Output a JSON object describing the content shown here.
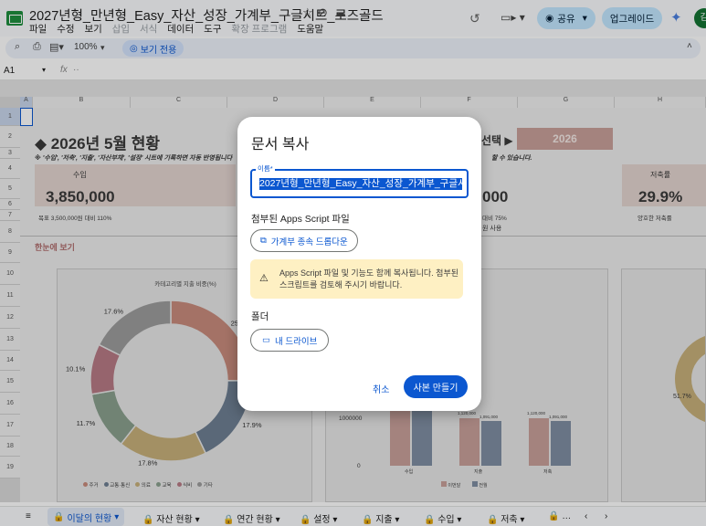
{
  "app": {
    "doc_title": "2027년형_만년형_Easy_자산_성장_가계부_구글시트_로즈골드",
    "menus": [
      "파일",
      "수정",
      "보기",
      "삽입",
      "서식",
      "데이터",
      "도구",
      "확장 프로그램",
      "도움말"
    ],
    "share_label": "공유",
    "upgrade_label": "업그레이드",
    "avatar_letter": "김"
  },
  "toolbar": {
    "zoom": "100%",
    "view_only": "보기 전용"
  },
  "formula_bar": {
    "cell_ref": "A1",
    "fx": "fx",
    "value": "··"
  },
  "columns": [
    "A",
    "B",
    "C",
    "D",
    "E",
    "F",
    "G",
    "H"
  ],
  "rows": [
    "1",
    "2",
    "3",
    "4",
    "5",
    "6",
    "7",
    "8",
    "9",
    "10",
    "11",
    "12",
    "13",
    "14",
    "15",
    "16",
    "17",
    "18",
    "19"
  ],
  "sheet": {
    "heading": "◆ 2026년 5월 현황",
    "subheading": "※ '수입', '저축', '지출', '자산부채', '설정' 시트에 기록하면 자동 반영됩니다",
    "subheading_tail": "할 수 있습니다.",
    "select_label": "선택 ▶",
    "year": "2026",
    "income_label": "수입",
    "income_value": "3,850,000",
    "income_goal": "목표 3,500,000원 대비 110%",
    "mid_value": "000",
    "mid_note1": "대비 75%",
    "mid_note2": "원 사용",
    "saving_label": "저축률",
    "saving_value": "29.9%",
    "saving_note": "양호한 저축률",
    "overview": "한눈에 보기",
    "chart_title": "카테고리별 지출 비중(%)",
    "right_pct": "51.7%",
    "bar_axis": [
      "1000000",
      "0"
    ],
    "bar_cats": [
      "수입",
      "지출",
      "저축"
    ],
    "bar_labels": [
      "1,120,000",
      "1,091,000",
      "1,120,000",
      "1,091,000"
    ],
    "bar_legend": [
      "이번달",
      "전월"
    ]
  },
  "chart_data": {
    "type": "pie",
    "title": "카테고리별 지출 비중(%)",
    "categories": [
      "주거",
      "교통·통신",
      "의료",
      "교육",
      "식비",
      "기타"
    ],
    "values": [
      25.0,
      17.9,
      17.8,
      11.7,
      10.1,
      17.6
    ],
    "colors": [
      "#c98b7d",
      "#6e7f93",
      "#c7b07a",
      "#8aa08e",
      "#b77b85",
      "#9d9d9d"
    ]
  },
  "dialog": {
    "title": "문서 복사",
    "name_label": "이름*",
    "name_value": "2027년형_만년형_Easy_자산_성장_가계부_구글시트_로즈골드",
    "attached_label": "첨부된 Apps Script 파일",
    "dependency_button": "가계부 종속 드롭다운",
    "warning": "Apps Script 파일 및 기능도 함께 복사됩니다. 첨부된 스크립트를 검토해 주시기 바랍니다.",
    "folder_label": "폴더",
    "folder_button": "내 드라이브",
    "cancel": "취소",
    "confirm": "사본 만들기"
  },
  "tabs": [
    "이달의 현황",
    "자산 현황",
    "연간 현황",
    "설정",
    "지출",
    "수입",
    "저축",
    "…"
  ]
}
